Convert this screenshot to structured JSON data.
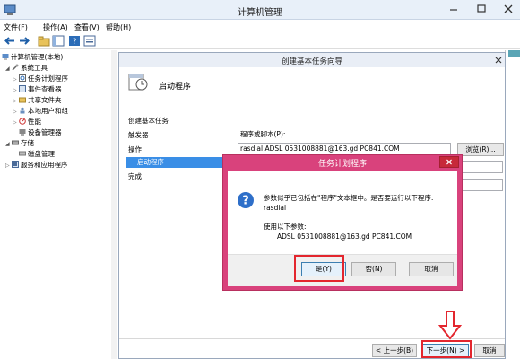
{
  "window": {
    "title": "计算机管理"
  },
  "menu": [
    "文件(F)",
    "操作(A)",
    "查看(V)",
    "帮助(H)"
  ],
  "tree": {
    "items": [
      {
        "label": "计算机管理(本地)",
        "icon": "computer-icon",
        "expander": ""
      },
      {
        "label": "系统工具",
        "icon": "tools-icon",
        "expander": "◢"
      },
      {
        "label": "任务计划程序",
        "icon": "task-scheduler-icon",
        "expander": "▷"
      },
      {
        "label": "事件查看器",
        "icon": "event-viewer-icon",
        "expander": "▷"
      },
      {
        "label": "共享文件夹",
        "icon": "shared-folder-icon",
        "expander": "▷"
      },
      {
        "label": "本地用户和组",
        "icon": "users-icon",
        "expander": "▷"
      },
      {
        "label": "性能",
        "icon": "performance-icon",
        "expander": "▷"
      },
      {
        "label": "设备管理器",
        "icon": "device-manager-icon",
        "expander": ""
      },
      {
        "label": "存储",
        "icon": "storage-icon",
        "expander": "◢"
      },
      {
        "label": "磁盘管理",
        "icon": "disk-icon",
        "expander": ""
      },
      {
        "label": "服务和应用程序",
        "icon": "services-icon",
        "expander": "▷"
      }
    ]
  },
  "wizard": {
    "title": "创建基本任务向导",
    "header": "启动程序",
    "steps": [
      "创建基本任务",
      "触发器",
      "操作",
      "启动程序",
      "完成"
    ],
    "program_label": "程序或脚本(P):",
    "program_value": "rasdial ADSL 0531008881@163.gd PC841.COM",
    "browse": "浏览(R)...",
    "back": "< 上一步(B)",
    "next": "下一步(N) >",
    "cancel": "取消"
  },
  "dialog": {
    "title": "任务计划程序",
    "line1": "参数似乎已包括在\"程序\"文本框中。是否要运行以下程序:",
    "line2": "rasdial",
    "line3": "使用以下参数:",
    "line4": "ADSL 0531008881@163.gd PC841.COM",
    "yes": "是(Y)",
    "no": "否(N)",
    "cancel": "取消"
  },
  "colors": {
    "dialog_frame": "#d9427c",
    "active_step": "#3a8ee6",
    "highlight": "#e3262e"
  }
}
